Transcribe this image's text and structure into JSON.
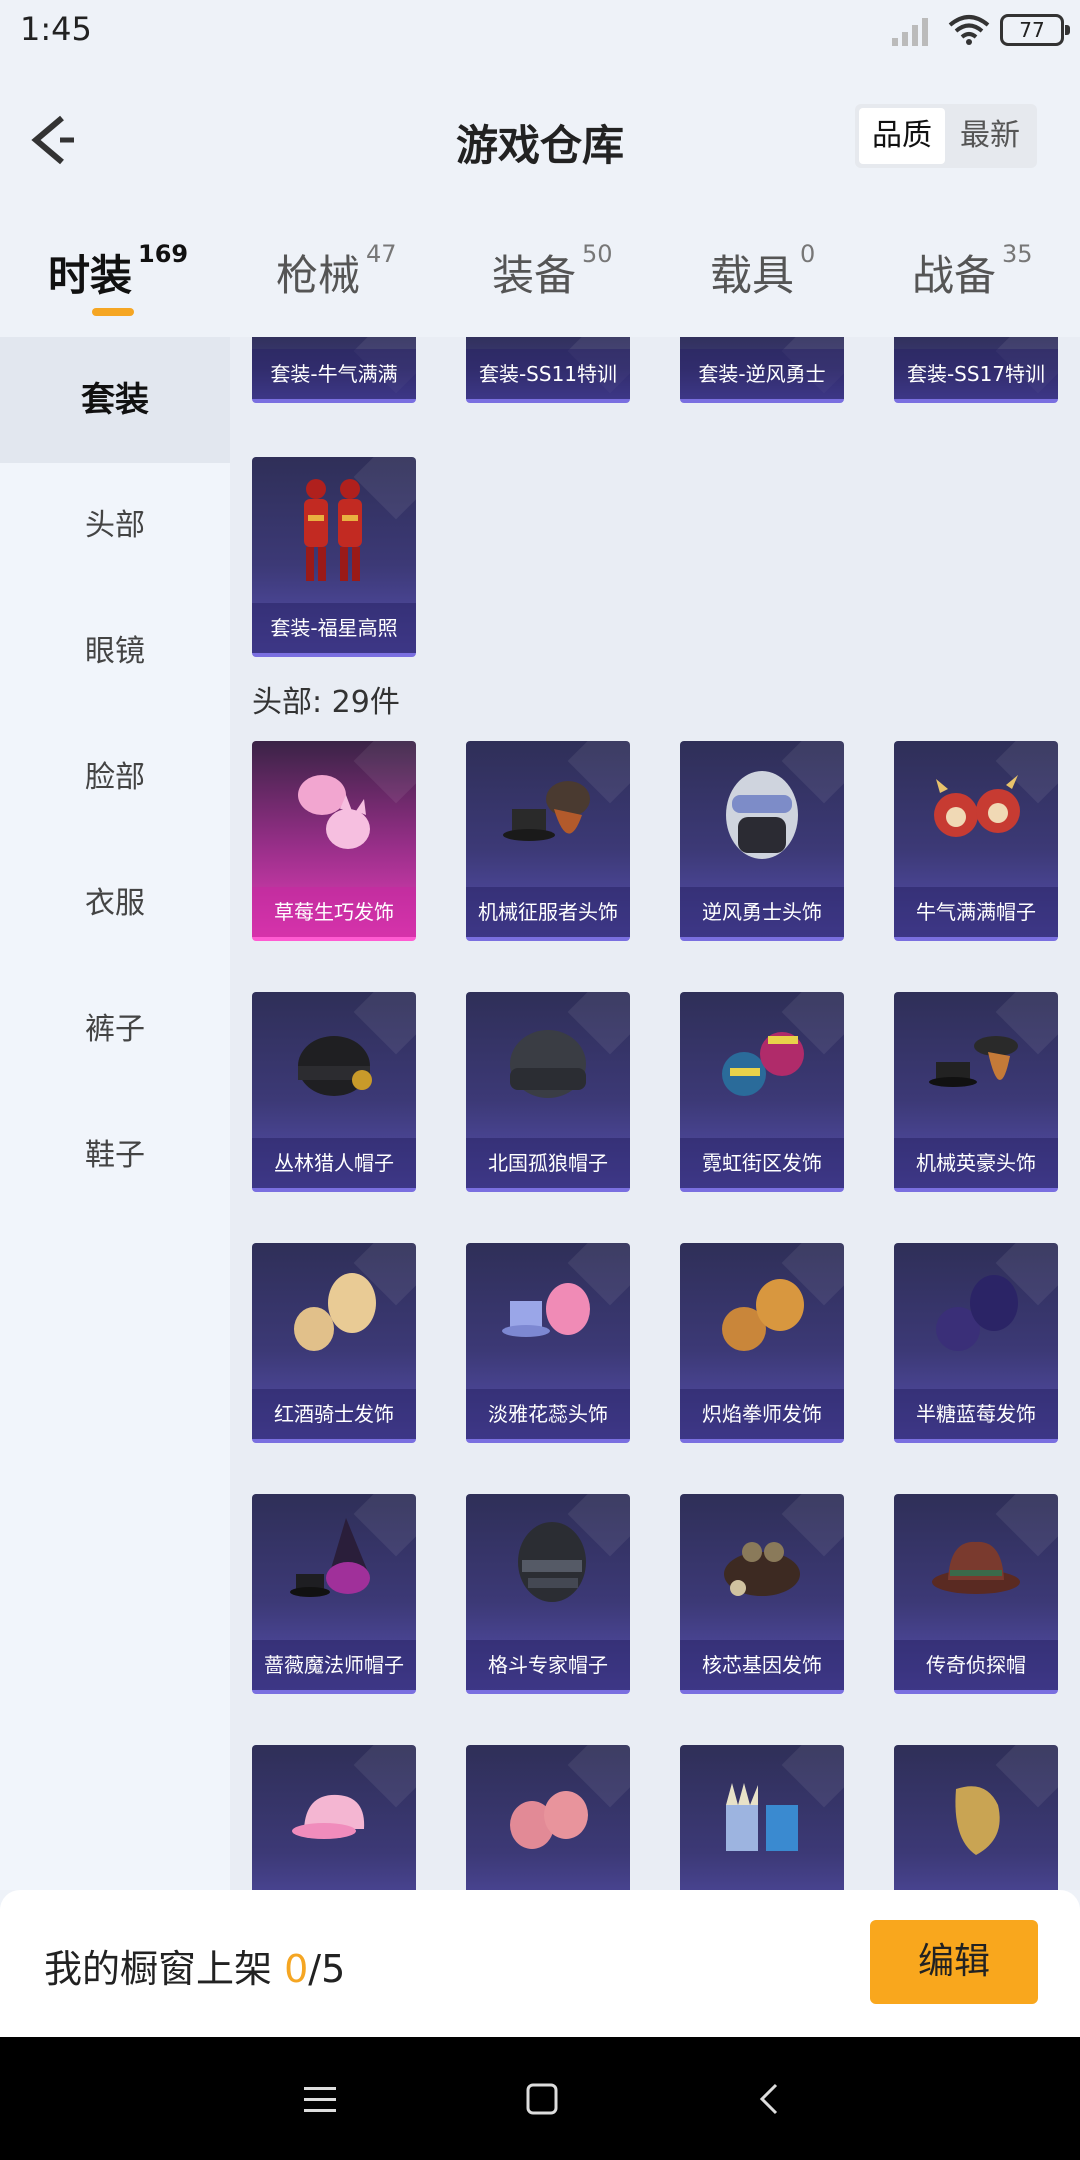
{
  "status": {
    "time": "1:45",
    "battery": "77"
  },
  "header": {
    "title": "游戏仓库",
    "sort_quality": "品质",
    "sort_latest": "最新"
  },
  "tabs": [
    {
      "label": "时装",
      "count": "169"
    },
    {
      "label": "枪械",
      "count": "47"
    },
    {
      "label": "装备",
      "count": "50"
    },
    {
      "label": "载具",
      "count": "0"
    },
    {
      "label": "战备",
      "count": "35"
    }
  ],
  "sidebar": [
    "套装",
    "头部",
    "眼镜",
    "脸部",
    "衣服",
    "裤子",
    "鞋子"
  ],
  "suits": [
    "套装-牛气满满",
    "套装-SS11特训",
    "套装-逆风勇士",
    "套装-SS17特训",
    "套装-福星高照"
  ],
  "head_section": "头部: 29件",
  "head_items": [
    "草莓生巧发饰",
    "机械征服者头饰",
    "逆风勇士头饰",
    "牛气满满帽子",
    "丛林猎人帽子",
    "北国孤狼帽子",
    "霓虹街区发饰",
    "机械英豪头饰",
    "红酒骑士发饰",
    "淡雅花蕊头饰",
    "炽焰拳师发饰",
    "半糖蓝莓发饰",
    "蔷薇魔法师帽子",
    "格斗专家帽子",
    "核芯基因发饰",
    "传奇侦探帽"
  ],
  "bottom": {
    "label": "我的橱窗上架 ",
    "count": "0",
    "total": "/5",
    "edit": "编辑"
  }
}
